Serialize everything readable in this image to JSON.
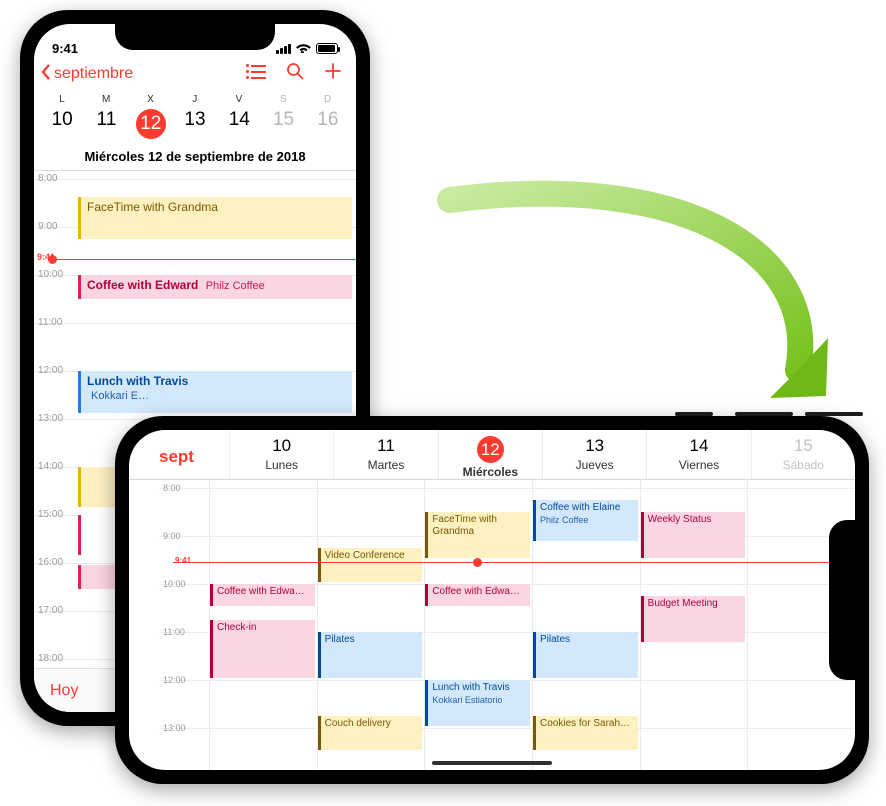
{
  "status_time": "9:41",
  "now_label": "9:41",
  "portrait": {
    "back_label": "septiembre",
    "date_title": "Miércoles 12 de septiembre de 2018",
    "week": [
      {
        "dow": "L",
        "num": "10"
      },
      {
        "dow": "M",
        "num": "11"
      },
      {
        "dow": "X",
        "num": "12",
        "selected": true
      },
      {
        "dow": "J",
        "num": "13"
      },
      {
        "dow": "V",
        "num": "14"
      },
      {
        "dow": "S",
        "num": "15",
        "weekend": true
      },
      {
        "dow": "D",
        "num": "16",
        "weekend": true
      }
    ],
    "hours": [
      "8:00",
      "9:00",
      "10:00",
      "11:00",
      "12:00",
      "13:00",
      "14:00",
      "15:00",
      "16:00",
      "17:00",
      "18:00"
    ],
    "events": {
      "facetime": "FaceTime with Grandma",
      "coffee_title": "Coffee with Edward",
      "coffee_loc": "Philz Coffee",
      "lunch_title": "Lunch with Travis",
      "lunch_loc": "Kokkari E…"
    },
    "footer_today": "Hoy"
  },
  "landscape": {
    "month_label": "sept",
    "days": [
      {
        "num": "10",
        "name": "Lunes"
      },
      {
        "num": "11",
        "name": "Martes"
      },
      {
        "num": "12",
        "name": "Miércoles",
        "selected": true
      },
      {
        "num": "13",
        "name": "Jueves"
      },
      {
        "num": "14",
        "name": "Viernes"
      },
      {
        "num": "15",
        "name": "Sábado",
        "weekend": true
      }
    ],
    "hours": [
      "8:00",
      "9:00",
      "10:00",
      "11:00",
      "12:00",
      "13:00"
    ],
    "events": {
      "video_conf": "Video Conference",
      "facetime": "FaceTime with Grandma",
      "coffee1": "Coffee with Edwa…",
      "coffee2": "Coffee with Edwa…",
      "checkin": "Check-in",
      "pilates1": "Pilates",
      "pilates2": "Pilates",
      "couch": "Couch delivery",
      "lunch_title": "Lunch with Travis",
      "lunch_loc": "Kokkari Estiatorio",
      "elaine_title": "Coffee with Elaine",
      "elaine_loc": "Philz Coffee",
      "cookies": "Cookies for Sarah…",
      "weekly": "Weekly Status",
      "budget": "Budget Meeting"
    }
  }
}
